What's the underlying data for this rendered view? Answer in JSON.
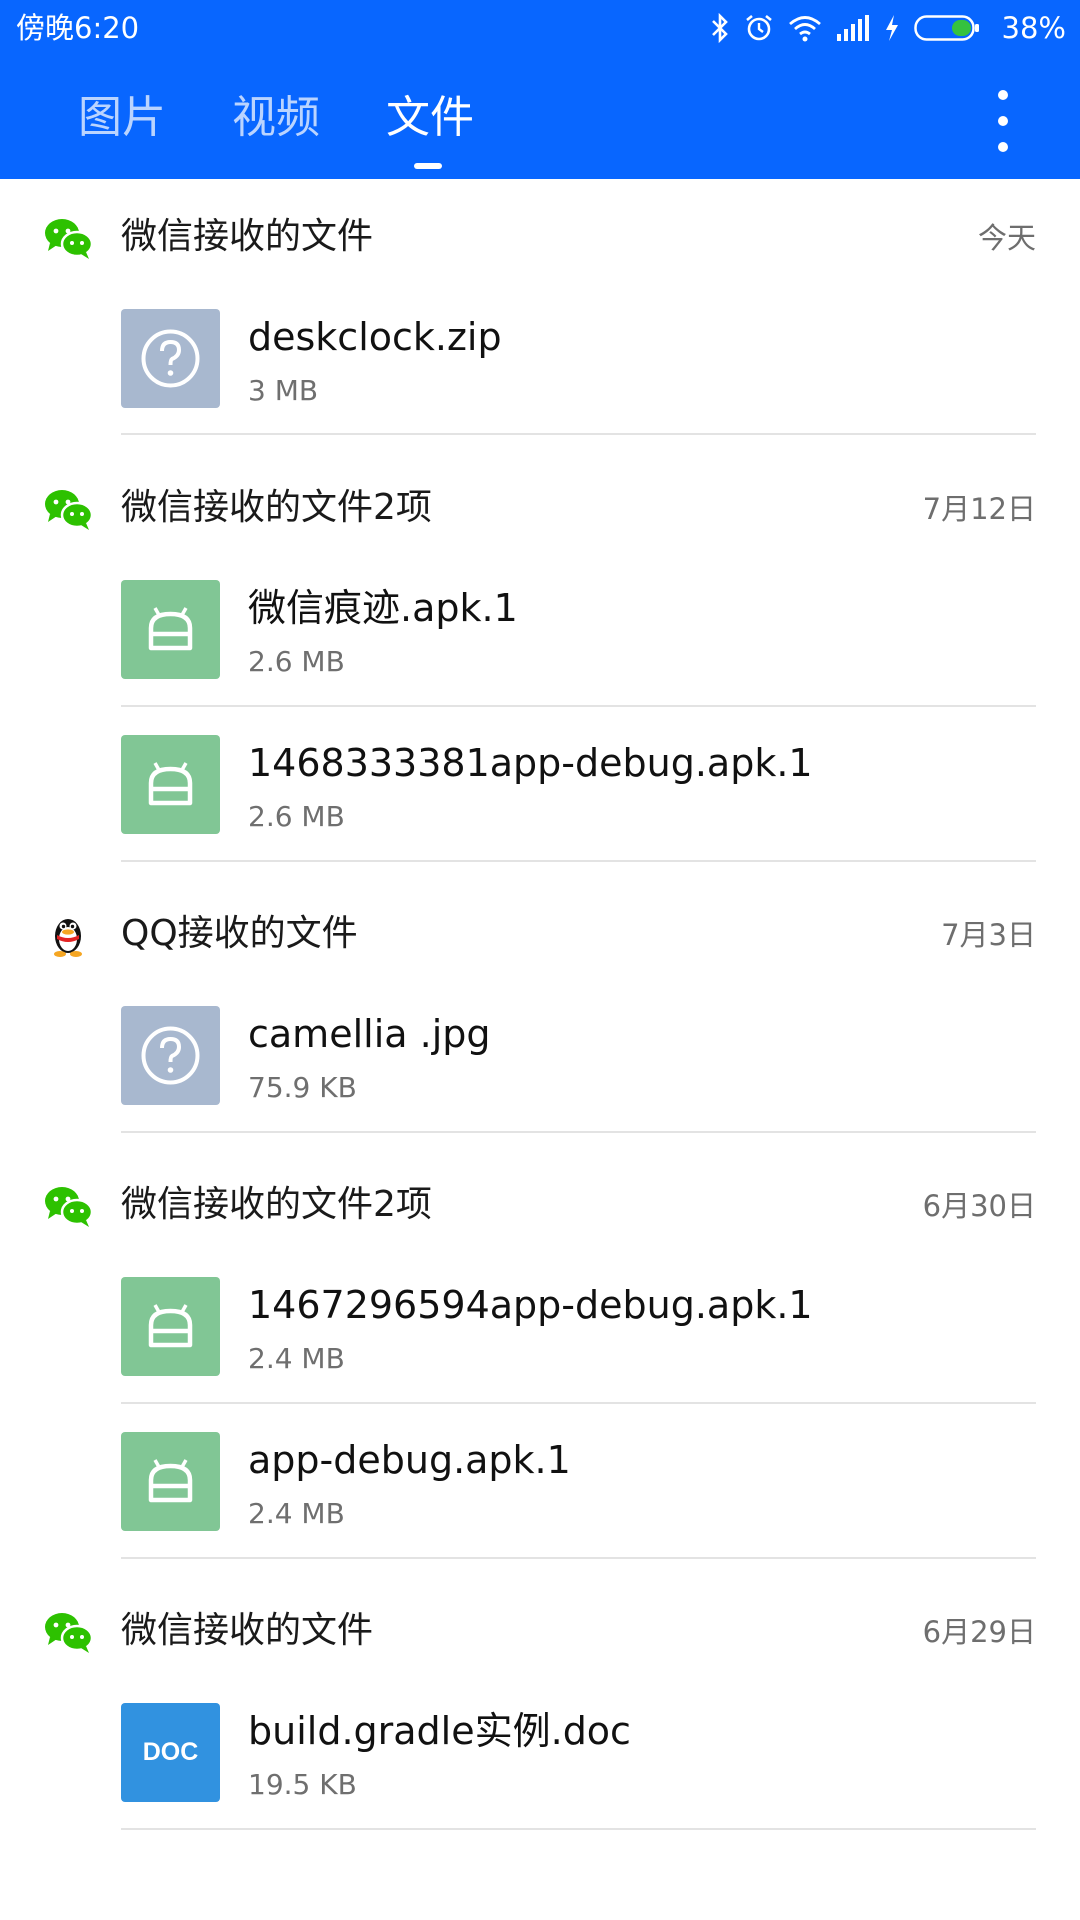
{
  "status_bar": {
    "time": "傍晚6:20",
    "battery_level": "38%"
  },
  "tabs": [
    {
      "label": "图片",
      "active": false
    },
    {
      "label": "视频",
      "active": false
    },
    {
      "label": "文件",
      "active": true
    }
  ],
  "colors": {
    "header_bg": "#0866ff",
    "apk_icon": "#81c695",
    "unknown_icon": "#a8b8cf",
    "doc_icon": "#3192e0",
    "wechat_green": "#2dc100"
  },
  "groups": [
    {
      "source_icon": "wechat-icon",
      "title": "微信接收的文件",
      "date": "今天",
      "files": [
        {
          "type_icon": "unknown-file-icon",
          "name": "deskclock.zip",
          "size": "3 MB"
        }
      ]
    },
    {
      "source_icon": "wechat-icon",
      "title": "微信接收的文件2项",
      "date": "7月12日",
      "files": [
        {
          "type_icon": "android-apk-icon",
          "name": "微信痕迹.apk.1",
          "size": "2.6 MB"
        },
        {
          "type_icon": "android-apk-icon",
          "name": "1468333381app-debug.apk.1",
          "size": "2.6 MB"
        }
      ]
    },
    {
      "source_icon": "qq-icon",
      "title": "QQ接收的文件",
      "date": "7月3日",
      "files": [
        {
          "type_icon": "unknown-file-icon",
          "name": "camellia .jpg",
          "size": "75.9 KB"
        }
      ]
    },
    {
      "source_icon": "wechat-icon",
      "title": "微信接收的文件2项",
      "date": "6月30日",
      "files": [
        {
          "type_icon": "android-apk-icon",
          "name": "1467296594app-debug.apk.1",
          "size": "2.4 MB"
        },
        {
          "type_icon": "android-apk-icon",
          "name": "app-debug.apk.1",
          "size": "2.4 MB"
        }
      ]
    },
    {
      "source_icon": "wechat-icon",
      "title": "微信接收的文件",
      "date": "6月29日",
      "files": [
        {
          "type_icon": "doc-file-icon",
          "name": "build.gradle实例.doc",
          "size": "19.5 KB",
          "badge": "DOC"
        }
      ]
    }
  ]
}
